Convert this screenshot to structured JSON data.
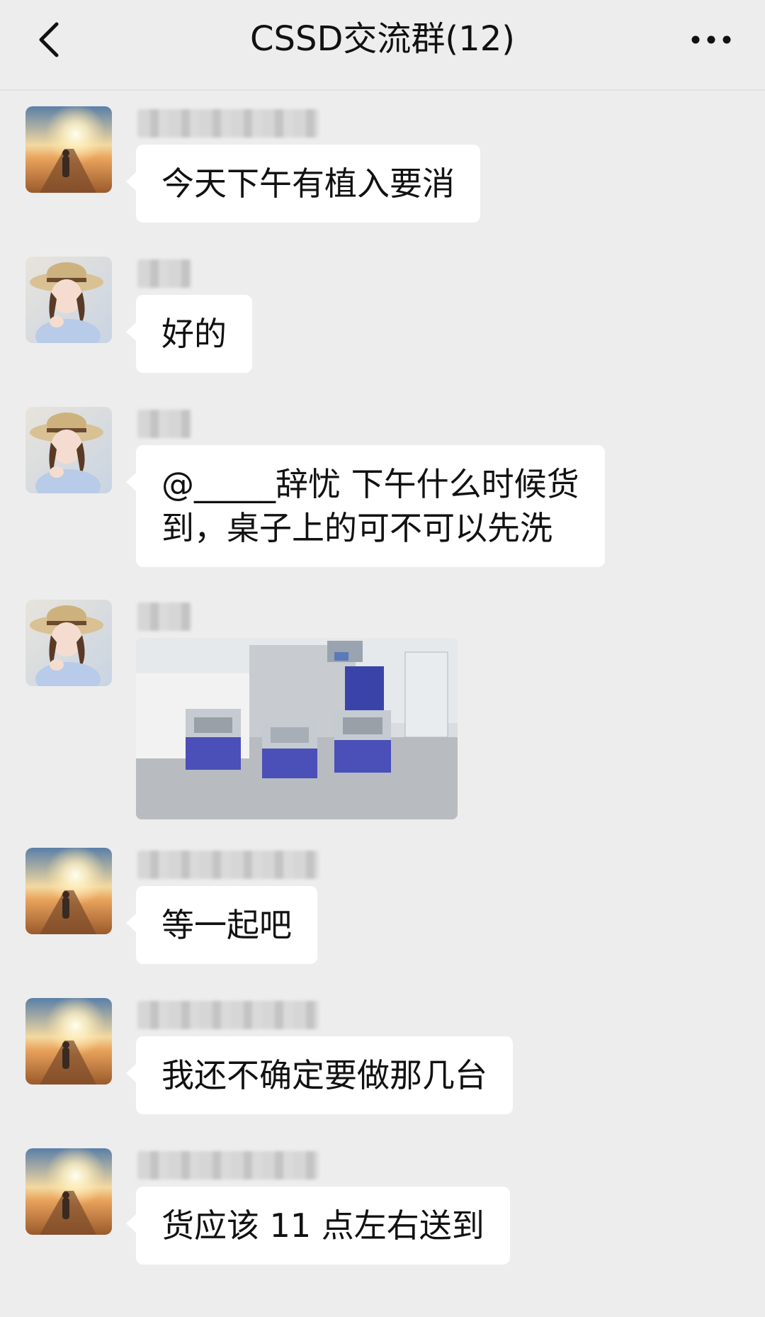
{
  "header": {
    "title": "CSSD交流群(12)",
    "back_icon": "chevron-left-icon",
    "more_icon": "more-dots-icon"
  },
  "messages": [
    {
      "avatar": "sunset-road-avatar",
      "text": "今天下午有植入要消"
    },
    {
      "avatar": "girl-straw-hat-avatar",
      "text": "好的"
    },
    {
      "avatar": "girl-straw-hat-avatar",
      "text_lines": [
        "@_____辞忧  下午什么时候货",
        "到，桌子上的可不可以先洗"
      ]
    },
    {
      "avatar": "girl-straw-hat-avatar",
      "image": "photo-instrument-containers"
    },
    {
      "avatar": "sunset-road-avatar",
      "text": "等一起吧"
    },
    {
      "avatar": "sunset-road-avatar",
      "text": "我还不确定要做那几台"
    },
    {
      "avatar": "sunset-road-avatar",
      "text": "货应该 11 点左右送到"
    }
  ],
  "colors": {
    "background": "#ededed",
    "bubble": "#ffffff",
    "text": "#111111"
  }
}
